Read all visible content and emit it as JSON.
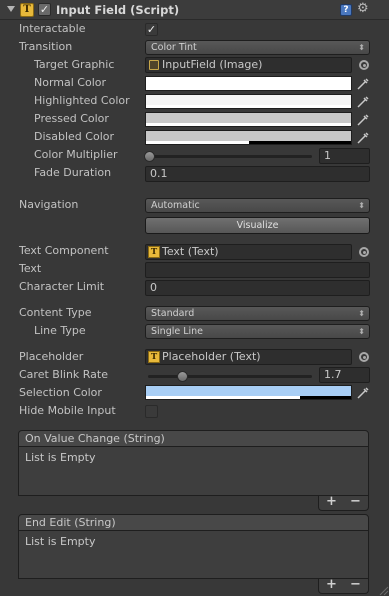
{
  "component": {
    "title": "Input Field (Script)",
    "enabled_checkmark": "✓"
  },
  "fields": {
    "interactable": {
      "label": "Interactable",
      "checked": true
    },
    "transition": {
      "label": "Transition",
      "value": "Color Tint"
    },
    "target_graphic": {
      "label": "Target Graphic",
      "value": "InputField (Image)"
    },
    "normal_color": {
      "label": "Normal Color",
      "color": "#ffffff",
      "alpha": 1.0
    },
    "highlighted_color": {
      "label": "Highlighted Color",
      "color": "#f5f5f5",
      "alpha": 1.0
    },
    "pressed_color": {
      "label": "Pressed Color",
      "color": "#c8c8c8",
      "alpha": 1.0
    },
    "disabled_color": {
      "label": "Disabled Color",
      "color": "#c8c8c8",
      "alpha": 0.5
    },
    "color_multiplier": {
      "label": "Color Multiplier",
      "value": "1",
      "slider_fraction": 0.0
    },
    "fade_duration": {
      "label": "Fade Duration",
      "value": "0.1"
    },
    "navigation": {
      "label": "Navigation",
      "value": "Automatic"
    },
    "visualize": {
      "label": "Visualize"
    },
    "text_component": {
      "label": "Text Component",
      "value": "Text (Text)"
    },
    "text": {
      "label": "Text",
      "value": ""
    },
    "character_limit": {
      "label": "Character Limit",
      "value": "0"
    },
    "content_type": {
      "label": "Content Type",
      "value": "Standard"
    },
    "line_type": {
      "label": "Line Type",
      "value": "Single Line"
    },
    "placeholder": {
      "label": "Placeholder",
      "value": "Placeholder (Text)"
    },
    "caret_blink_rate": {
      "label": "Caret Blink Rate",
      "value": "1.7",
      "slider_fraction": 0.2
    },
    "selection_color": {
      "label": "Selection Color",
      "color": "#a8cef5",
      "alpha": 0.75
    },
    "hide_mobile_input": {
      "label": "Hide Mobile Input",
      "checked": false
    }
  },
  "events": [
    {
      "title": "On Value Change (String)",
      "body": "List is Empty",
      "add": "+",
      "remove": "−"
    },
    {
      "title": "End Edit (String)",
      "body": "List is Empty",
      "add": "+",
      "remove": "−"
    }
  ],
  "icons": {
    "foldout": "triangle-down-icon",
    "script": "script-icon",
    "help": "help-icon",
    "gear": "gear-icon",
    "picker": "object-picker-icon",
    "eyedropper": "eyedropper-icon"
  }
}
